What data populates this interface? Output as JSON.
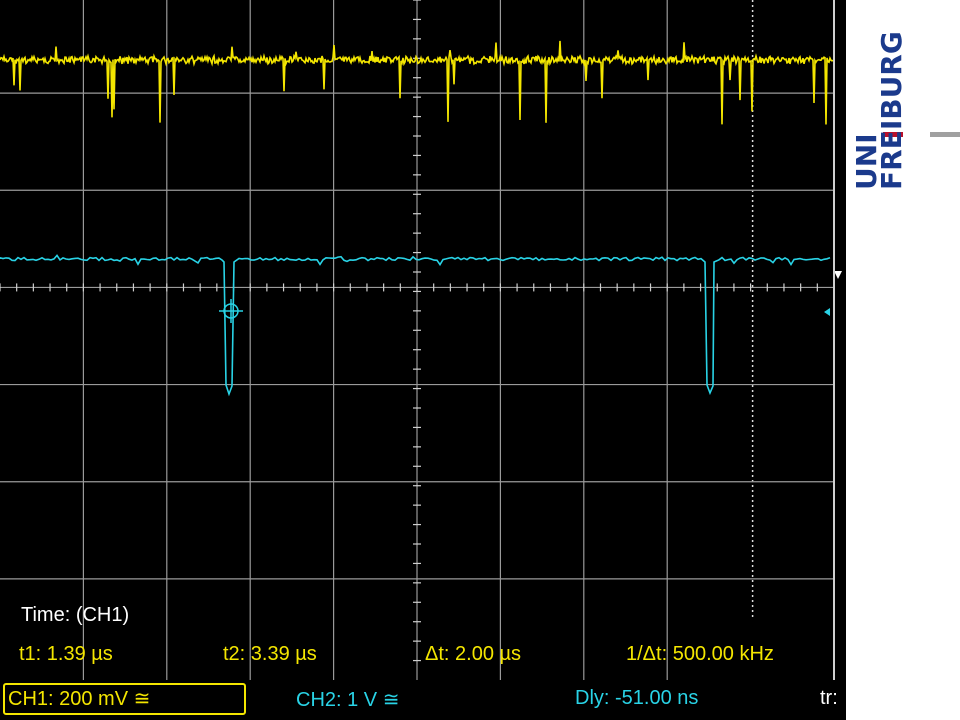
{
  "measurement": {
    "title": "Time: (CH1)",
    "t1": "t1: 1.39 µs",
    "t2": "t2: 3.39 µs",
    "dt": "Δt: 2.00 µs",
    "inv_dt": "1/Δt: 500.00 kHz"
  },
  "status": {
    "ch1": "CH1: 200 mV ≅",
    "ch2": "CH2: 1 V ≅",
    "delay": "Dly: -51.00 ns",
    "trigger": "tr:"
  },
  "logo": {
    "line1": "UNI",
    "line2": "FREIBURG"
  },
  "colors": {
    "ch1": "#f4e600",
    "ch2": "#29d3e6",
    "grid": "#9a9a9a",
    "logo_blue": "#1b3a8c",
    "logo_red": "#b8102b",
    "logo_gray": "#a0a0a0"
  }
}
